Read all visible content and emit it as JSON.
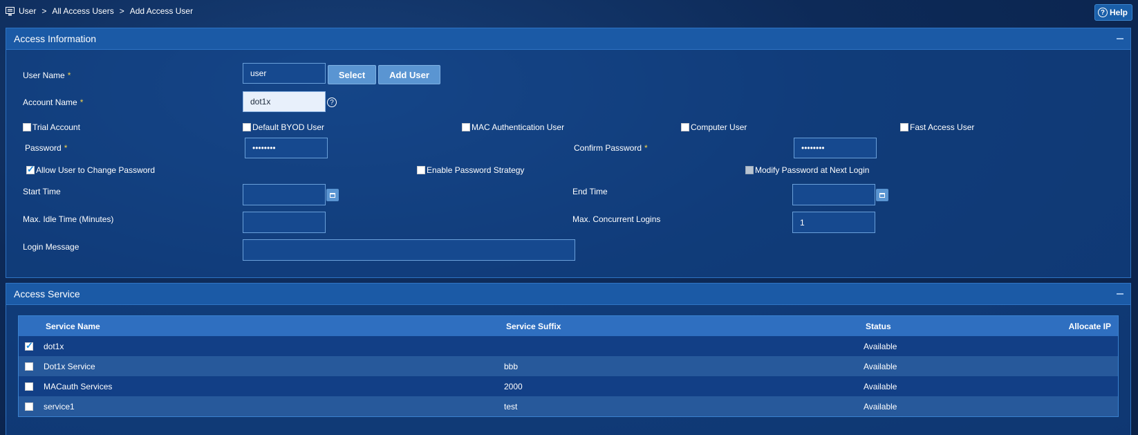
{
  "breadcrumb": {
    "items": [
      "User",
      "All Access Users",
      "Add Access User"
    ],
    "separator": ">"
  },
  "help_label": "Help",
  "access_information": {
    "title": "Access Information",
    "user_name": {
      "label": "User Name",
      "value": "user",
      "select_label": "Select",
      "add_user_label": "Add User"
    },
    "account_name": {
      "label": "Account Name",
      "value": "dot1x"
    },
    "user_types": [
      {
        "label": "Trial Account",
        "checked": false
      },
      {
        "label": "Default BYOD User",
        "checked": false
      },
      {
        "label": "MAC Authentication User",
        "checked": false
      },
      {
        "label": "Computer User",
        "checked": false
      },
      {
        "label": "Fast Access User",
        "checked": false
      }
    ],
    "password": {
      "label": "Password",
      "value": "••••••••"
    },
    "confirm_password": {
      "label": "Confirm Password",
      "value": "••••••••"
    },
    "password_options": [
      {
        "label": "Allow User to Change Password",
        "checked": true
      },
      {
        "label": "Enable Password Strategy",
        "checked": false
      },
      {
        "label": "Modify Password at Next Login",
        "checked": false,
        "disabled": true
      }
    ],
    "start_time": {
      "label": "Start Time",
      "value": ""
    },
    "end_time": {
      "label": "End Time",
      "value": ""
    },
    "max_idle": {
      "label": "Max. Idle Time (Minutes)",
      "value": ""
    },
    "max_logins": {
      "label": "Max. Concurrent Logins",
      "value": "1"
    },
    "login_message": {
      "label": "Login Message",
      "value": ""
    }
  },
  "access_service": {
    "title": "Access Service",
    "columns": [
      "Service Name",
      "Service Suffix",
      "Status",
      "Allocate IP"
    ],
    "rows": [
      {
        "name": "dot1x",
        "suffix": "",
        "status": "Available",
        "checked": true
      },
      {
        "name": "Dot1x Service",
        "suffix": "bbb",
        "status": "Available",
        "checked": false
      },
      {
        "name": "MACauth Services",
        "suffix": "2000",
        "status": "Available",
        "checked": false
      },
      {
        "name": "service1",
        "suffix": "test",
        "status": "Available",
        "checked": false
      }
    ]
  },
  "colors": {
    "accent": "#1b5aa6",
    "required": "#f5d44b",
    "button": "#5a95d2"
  }
}
